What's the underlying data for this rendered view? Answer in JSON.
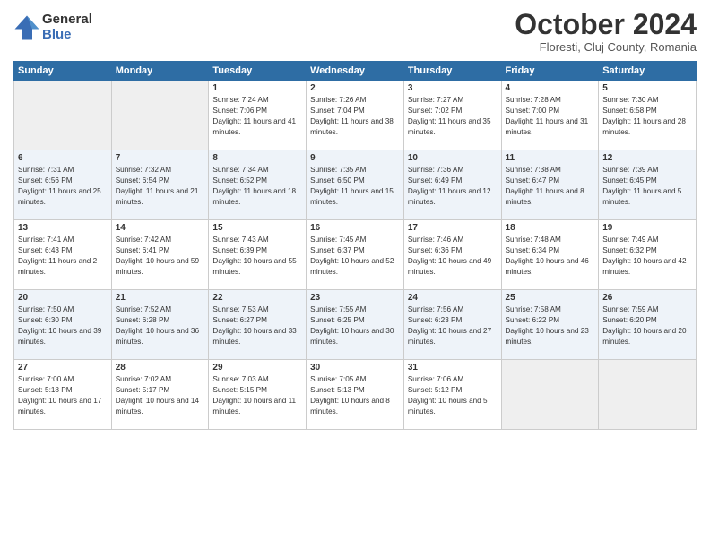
{
  "header": {
    "logo_general": "General",
    "logo_blue": "Blue",
    "month": "October 2024",
    "location": "Floresti, Cluj County, Romania"
  },
  "days_of_week": [
    "Sunday",
    "Monday",
    "Tuesday",
    "Wednesday",
    "Thursday",
    "Friday",
    "Saturday"
  ],
  "weeks": [
    [
      {
        "num": "",
        "info": "",
        "empty": true
      },
      {
        "num": "",
        "info": "",
        "empty": true
      },
      {
        "num": "1",
        "info": "Sunrise: 7:24 AM\nSunset: 7:06 PM\nDaylight: 11 hours and 41 minutes."
      },
      {
        "num": "2",
        "info": "Sunrise: 7:26 AM\nSunset: 7:04 PM\nDaylight: 11 hours and 38 minutes."
      },
      {
        "num": "3",
        "info": "Sunrise: 7:27 AM\nSunset: 7:02 PM\nDaylight: 11 hours and 35 minutes."
      },
      {
        "num": "4",
        "info": "Sunrise: 7:28 AM\nSunset: 7:00 PM\nDaylight: 11 hours and 31 minutes."
      },
      {
        "num": "5",
        "info": "Sunrise: 7:30 AM\nSunset: 6:58 PM\nDaylight: 11 hours and 28 minutes."
      }
    ],
    [
      {
        "num": "6",
        "info": "Sunrise: 7:31 AM\nSunset: 6:56 PM\nDaylight: 11 hours and 25 minutes."
      },
      {
        "num": "7",
        "info": "Sunrise: 7:32 AM\nSunset: 6:54 PM\nDaylight: 11 hours and 21 minutes."
      },
      {
        "num": "8",
        "info": "Sunrise: 7:34 AM\nSunset: 6:52 PM\nDaylight: 11 hours and 18 minutes."
      },
      {
        "num": "9",
        "info": "Sunrise: 7:35 AM\nSunset: 6:50 PM\nDaylight: 11 hours and 15 minutes."
      },
      {
        "num": "10",
        "info": "Sunrise: 7:36 AM\nSunset: 6:49 PM\nDaylight: 11 hours and 12 minutes."
      },
      {
        "num": "11",
        "info": "Sunrise: 7:38 AM\nSunset: 6:47 PM\nDaylight: 11 hours and 8 minutes."
      },
      {
        "num": "12",
        "info": "Sunrise: 7:39 AM\nSunset: 6:45 PM\nDaylight: 11 hours and 5 minutes."
      }
    ],
    [
      {
        "num": "13",
        "info": "Sunrise: 7:41 AM\nSunset: 6:43 PM\nDaylight: 11 hours and 2 minutes."
      },
      {
        "num": "14",
        "info": "Sunrise: 7:42 AM\nSunset: 6:41 PM\nDaylight: 10 hours and 59 minutes."
      },
      {
        "num": "15",
        "info": "Sunrise: 7:43 AM\nSunset: 6:39 PM\nDaylight: 10 hours and 55 minutes."
      },
      {
        "num": "16",
        "info": "Sunrise: 7:45 AM\nSunset: 6:37 PM\nDaylight: 10 hours and 52 minutes."
      },
      {
        "num": "17",
        "info": "Sunrise: 7:46 AM\nSunset: 6:36 PM\nDaylight: 10 hours and 49 minutes."
      },
      {
        "num": "18",
        "info": "Sunrise: 7:48 AM\nSunset: 6:34 PM\nDaylight: 10 hours and 46 minutes."
      },
      {
        "num": "19",
        "info": "Sunrise: 7:49 AM\nSunset: 6:32 PM\nDaylight: 10 hours and 42 minutes."
      }
    ],
    [
      {
        "num": "20",
        "info": "Sunrise: 7:50 AM\nSunset: 6:30 PM\nDaylight: 10 hours and 39 minutes."
      },
      {
        "num": "21",
        "info": "Sunrise: 7:52 AM\nSunset: 6:28 PM\nDaylight: 10 hours and 36 minutes."
      },
      {
        "num": "22",
        "info": "Sunrise: 7:53 AM\nSunset: 6:27 PM\nDaylight: 10 hours and 33 minutes."
      },
      {
        "num": "23",
        "info": "Sunrise: 7:55 AM\nSunset: 6:25 PM\nDaylight: 10 hours and 30 minutes."
      },
      {
        "num": "24",
        "info": "Sunrise: 7:56 AM\nSunset: 6:23 PM\nDaylight: 10 hours and 27 minutes."
      },
      {
        "num": "25",
        "info": "Sunrise: 7:58 AM\nSunset: 6:22 PM\nDaylight: 10 hours and 23 minutes."
      },
      {
        "num": "26",
        "info": "Sunrise: 7:59 AM\nSunset: 6:20 PM\nDaylight: 10 hours and 20 minutes."
      }
    ],
    [
      {
        "num": "27",
        "info": "Sunrise: 7:00 AM\nSunset: 5:18 PM\nDaylight: 10 hours and 17 minutes."
      },
      {
        "num": "28",
        "info": "Sunrise: 7:02 AM\nSunset: 5:17 PM\nDaylight: 10 hours and 14 minutes."
      },
      {
        "num": "29",
        "info": "Sunrise: 7:03 AM\nSunset: 5:15 PM\nDaylight: 10 hours and 11 minutes."
      },
      {
        "num": "30",
        "info": "Sunrise: 7:05 AM\nSunset: 5:13 PM\nDaylight: 10 hours and 8 minutes."
      },
      {
        "num": "31",
        "info": "Sunrise: 7:06 AM\nSunset: 5:12 PM\nDaylight: 10 hours and 5 minutes."
      },
      {
        "num": "",
        "info": "",
        "empty": true
      },
      {
        "num": "",
        "info": "",
        "empty": true
      }
    ]
  ]
}
